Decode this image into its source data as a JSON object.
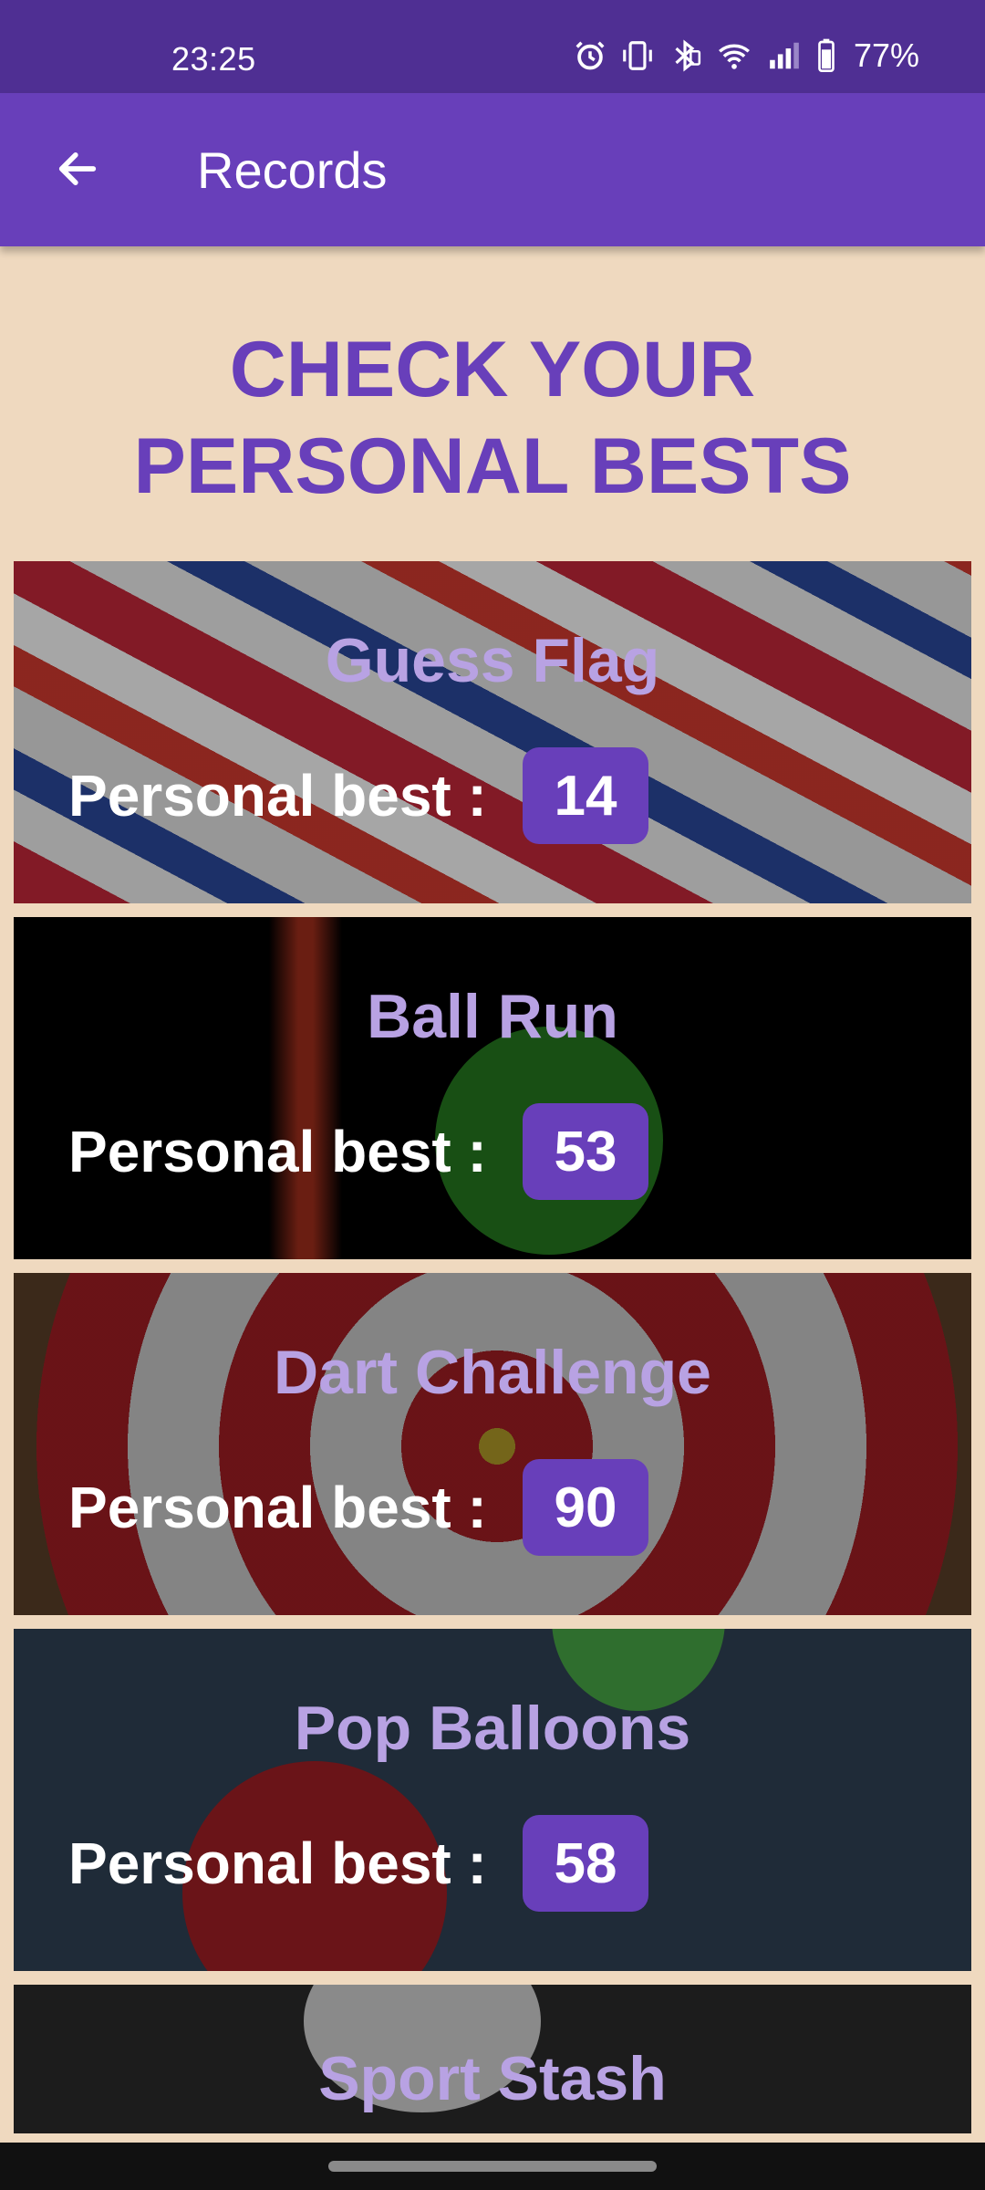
{
  "status_bar": {
    "time": "23:25",
    "battery": "77%",
    "icons": [
      "alarm-icon",
      "vibrate-icon",
      "bluetooth-icon",
      "wifi-icon",
      "signal-icon",
      "battery-icon"
    ]
  },
  "app_bar": {
    "title": "Records",
    "back_icon": "arrow-left-icon"
  },
  "heading": "CHECK YOUR PERSONAL BESTS",
  "colors": {
    "accent": "#683fba",
    "status_bar": "#4f2f93",
    "background": "#efd9bf",
    "card_title": "#b8a2e3"
  },
  "records": [
    {
      "game": "Guess Flag",
      "label": "Personal best :",
      "value": "14"
    },
    {
      "game": "Ball Run",
      "label": "Personal best :",
      "value": "53"
    },
    {
      "game": "Dart Challenge",
      "label": "Personal best :",
      "value": "90"
    },
    {
      "game": "Pop Balloons",
      "label": "Personal best :",
      "value": "58"
    },
    {
      "game": "Sport Stash"
    }
  ]
}
